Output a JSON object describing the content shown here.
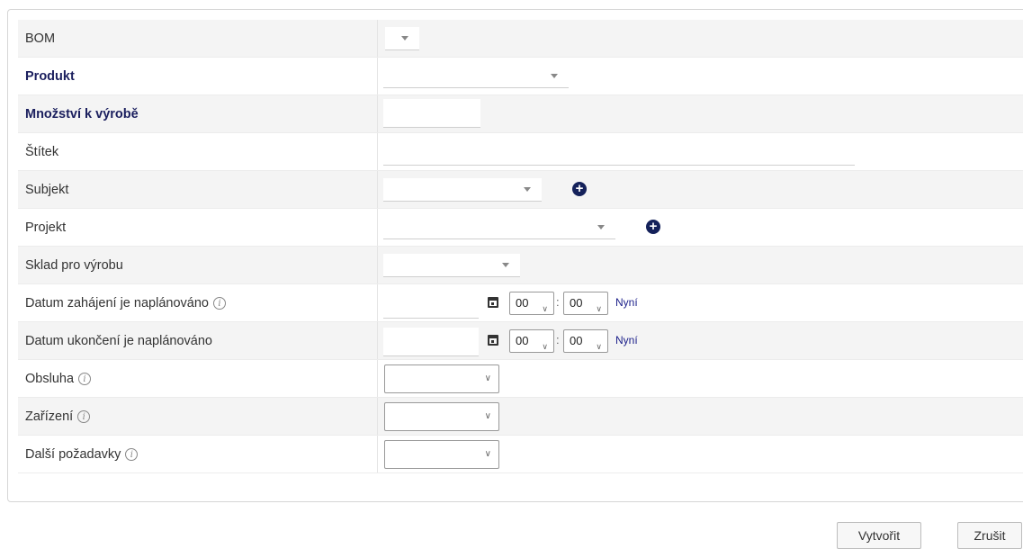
{
  "form": {
    "rows": [
      {
        "label": "BOM"
      },
      {
        "label": "Produkt"
      },
      {
        "label": "Množství k výrobě"
      },
      {
        "label": "Štítek"
      },
      {
        "label": "Subjekt"
      },
      {
        "label": "Projekt"
      },
      {
        "label": "Sklad pro výrobu"
      },
      {
        "label": "Datum zahájení je naplánováno",
        "hour": "00",
        "minute": "00",
        "now_label": "Nyní"
      },
      {
        "label": "Datum ukončení je naplánováno",
        "hour": "00",
        "minute": "00",
        "now_label": "Nyní"
      },
      {
        "label": "Obsluha"
      },
      {
        "label": "Zařízení"
      },
      {
        "label": "Další požadavky"
      }
    ],
    "time_separator": ":",
    "info_glyph": "i",
    "plus_glyph": "+",
    "chevron_glyph": "∨"
  },
  "buttons": {
    "create": "Vytvořit",
    "cancel": "Zrušit"
  },
  "colors": {
    "required_label": "#1b1f5e",
    "accent": "#14215a",
    "link": "#1b1f8a"
  }
}
